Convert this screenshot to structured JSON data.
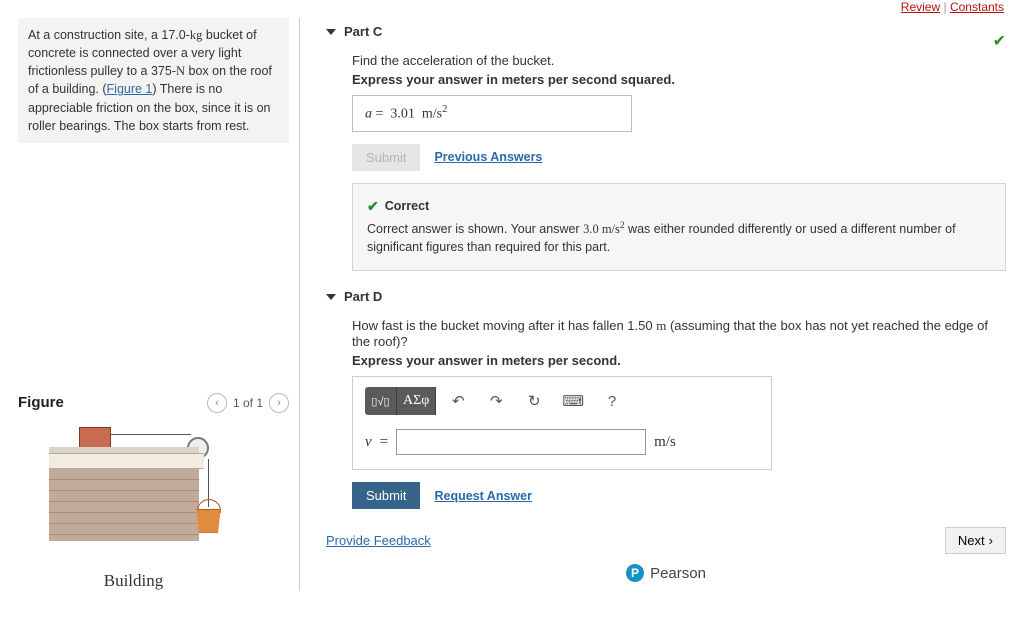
{
  "top_links": {
    "review": "Review",
    "sep": "|",
    "constants": "Constants"
  },
  "problem": {
    "text_pre": "At a construction site, a 17.0-",
    "kg": "kg",
    "text_mid1": " bucket of concrete is connected over a very light frictionless pulley to a 375-",
    "N": "N",
    "text_mid2": " box on the roof of a building. (",
    "figure_link": "Figure 1",
    "text_post": ") There is no appreciable friction on the box, since it is on roller bearings. The box starts from rest."
  },
  "figure": {
    "title": "Figure",
    "pager": "1 of 1",
    "building_label": "Building"
  },
  "partC": {
    "title": "Part C",
    "prompt": "Find the acceleration of the bucket.",
    "instruct": "Express your answer in meters per second squared.",
    "answer_var": "a",
    "answer_eq": "=",
    "answer_val": "3.01",
    "answer_unit_base": "m/s",
    "answer_unit_exp": "2",
    "submit": "Submit",
    "prev": "Previous Answers",
    "feedback_title": "Correct",
    "feedback_msg_pre": "Correct answer is shown. Your answer ",
    "feedback_your_answer": "3.0 m/s",
    "feedback_exp": "2",
    "feedback_msg_post": " was either rounded differently or used a different number of significant figures than required for this part."
  },
  "partD": {
    "title": "Part D",
    "prompt_pre": "How fast is the bucket moving after it has fallen 1.50 ",
    "prompt_m": "m",
    "prompt_post": " (assuming that the box has not yet reached the edge of the roof)?",
    "instruct": "Express your answer in meters per second.",
    "toolbar": {
      "templates": "▯√▯",
      "greek": "ΑΣφ",
      "undo": "↶",
      "redo": "↷",
      "reset": "↻",
      "keyboard": "⌨",
      "help": "?"
    },
    "var": "v",
    "eq": "=",
    "value": "",
    "unit": "m/s",
    "submit": "Submit",
    "request": "Request Answer"
  },
  "footer": {
    "provide_feedback": "Provide Feedback",
    "next": "Next",
    "brand": "Pearson",
    "brand_p": "P"
  }
}
